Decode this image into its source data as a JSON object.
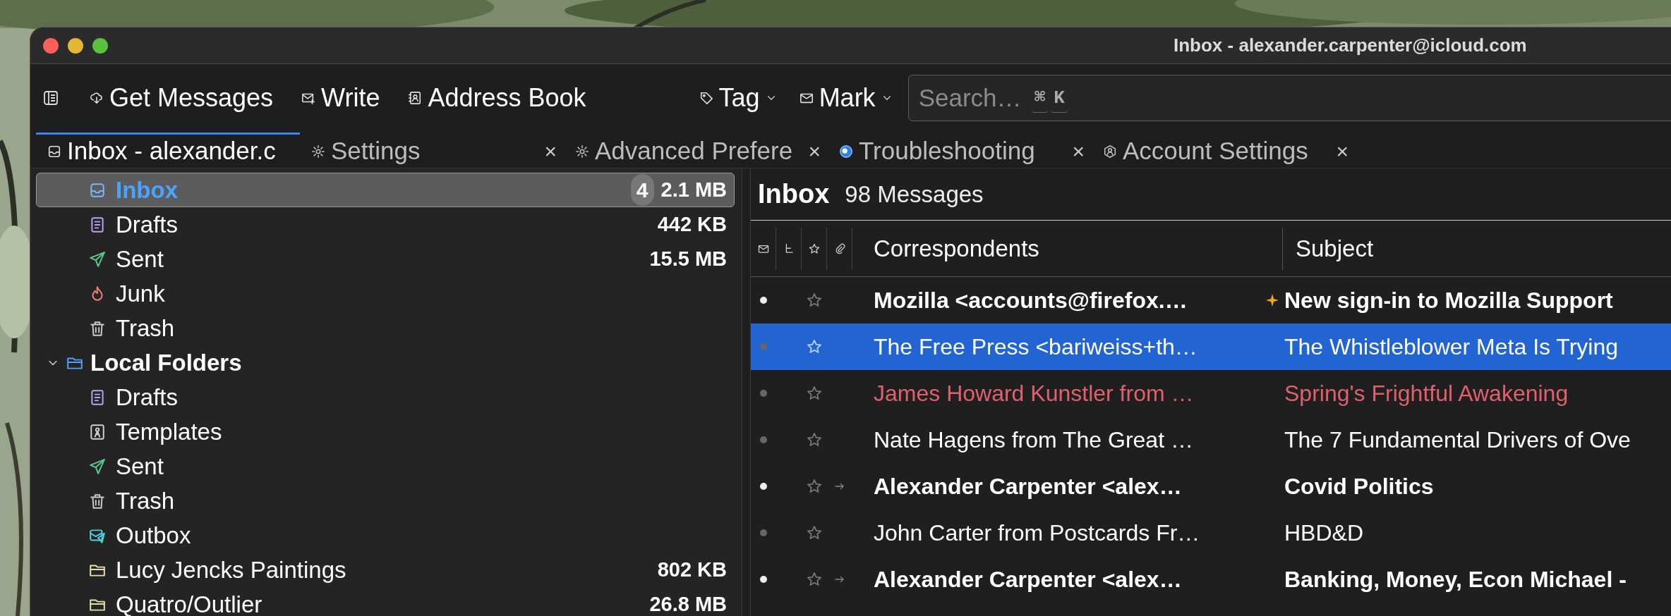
{
  "window": {
    "title": "Inbox - alexander.carpenter@icloud.com"
  },
  "toolbar": {
    "buttons": [
      {
        "kind": "get",
        "label": "Get Messages"
      },
      {
        "kind": "write",
        "label": "Write"
      },
      {
        "kind": "addressbook",
        "label": "Address Book"
      },
      {
        "kind": "tag",
        "label": "Tag"
      },
      {
        "kind": "mark",
        "label": "Mark"
      }
    ],
    "search": {
      "placeholder": "Search…",
      "shortcut": [
        "⌘",
        "K"
      ]
    }
  },
  "tabs": [
    {
      "kind": "inbox",
      "label": "Inbox - alexander.c",
      "selected": true,
      "closable": false
    },
    {
      "kind": "gear",
      "label": "Settings",
      "selected": false,
      "closable": true
    },
    {
      "kind": "gear",
      "label": "Advanced Prefere",
      "selected": false,
      "closable": true
    },
    {
      "kind": "globe",
      "label": "Troubleshooting",
      "selected": false,
      "closable": true
    },
    {
      "kind": "account",
      "label": "Account Settings",
      "selected": false,
      "closable": true
    }
  ],
  "tab_close": "×",
  "folders": [
    {
      "kind": "inbox",
      "label": "Inbox",
      "selected": true,
      "unread": "4",
      "size": "2.1 MB"
    },
    {
      "kind": "drafts",
      "label": "Drafts",
      "selected": false,
      "size": "442 KB"
    },
    {
      "kind": "sent",
      "label": "Sent",
      "selected": false,
      "size": "15.5 MB"
    },
    {
      "kind": "junk",
      "label": "Junk",
      "selected": false
    },
    {
      "kind": "trash",
      "label": "Trash",
      "selected": false
    },
    {
      "kind": "account",
      "label": "Local Folders",
      "selected": false,
      "expanded": true,
      "children": [
        {
          "kind": "drafts",
          "label": "Drafts",
          "selected": false
        },
        {
          "kind": "templates",
          "label": "Templates",
          "selected": false
        },
        {
          "kind": "sent",
          "label": "Sent",
          "selected": false
        },
        {
          "kind": "trash",
          "label": "Trash",
          "selected": false
        },
        {
          "kind": "outbox",
          "label": "Outbox",
          "selected": false
        },
        {
          "kind": "folder",
          "label": "Lucy Jencks Paintings",
          "selected": false,
          "size": "802 KB"
        },
        {
          "kind": "folder",
          "label": "Quatro/Outlier",
          "selected": false,
          "size": "26.8 MB"
        }
      ]
    }
  ],
  "message_list": {
    "title": "Inbox",
    "count": "98 Messages",
    "columns": [
      "Correspondents",
      "Subject"
    ],
    "rows": [
      {
        "correspondent": "Mozilla <accounts@firefox.…",
        "subject": "New sign-in to Mozilla Support",
        "unread": true,
        "selected": false,
        "new": true,
        "forwarded": false
      },
      {
        "correspondent": "The Free Press <bariweiss+th…",
        "subject": "The Whistleblower Meta Is Trying",
        "unread": false,
        "selected": true,
        "new": false,
        "forwarded": false
      },
      {
        "correspondent": "James Howard Kunstler from …",
        "subject": "Spring's Frightful Awakening",
        "unread": false,
        "selected": false,
        "new": false,
        "forwarded": false,
        "color": "#e0606e"
      },
      {
        "correspondent": "Nate Hagens from The Great …",
        "subject": "The 7 Fundamental Drivers of Ove",
        "unread": false,
        "selected": false,
        "new": false,
        "forwarded": false
      },
      {
        "correspondent": "Alexander Carpenter <alex…",
        "subject": "Covid Politics",
        "unread": true,
        "selected": false,
        "new": false,
        "forwarded": true
      },
      {
        "correspondent": "John Carter from Postcards Fr…",
        "subject": "HBD&D",
        "unread": false,
        "selected": false,
        "new": false,
        "forwarded": false
      },
      {
        "correspondent": "Alexander Carpenter <alex…",
        "subject": "Banking, Money, Econ Michael -",
        "unread": true,
        "selected": false,
        "new": false,
        "forwarded": true
      }
    ]
  }
}
